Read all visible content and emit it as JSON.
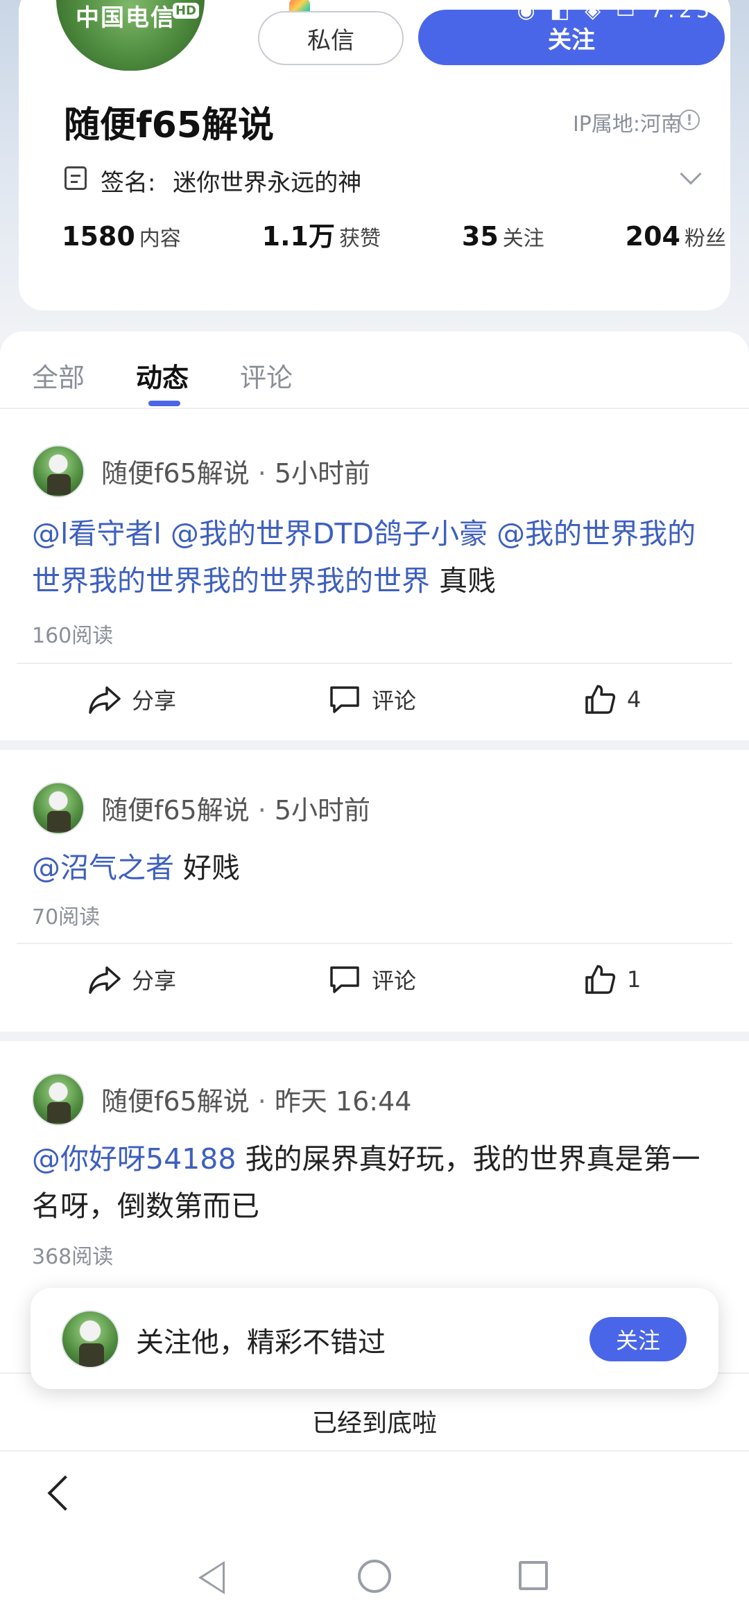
{
  "status_bar": {
    "time": "7:23",
    "carrier": "中国电信",
    "carrier_badge": "HD"
  },
  "profile": {
    "name": "随便f65解说",
    "ip_location": "IP属地:河南",
    "signature_label": "签名:",
    "signature": "迷你世界永远的神",
    "message_button": "私信",
    "follow_button": "关注",
    "stats": [
      {
        "value": "1580",
        "label": "内容"
      },
      {
        "value": "1.1万",
        "label": "获赞"
      },
      {
        "value": "35",
        "label": "关注"
      },
      {
        "value": "204",
        "label": "粉丝"
      }
    ]
  },
  "tabs": [
    {
      "label": "全部",
      "active": false
    },
    {
      "label": "动态",
      "active": true
    },
    {
      "label": "评论",
      "active": false
    }
  ],
  "posts": [
    {
      "author": "随便f65解说",
      "time": "5小时前",
      "mentions": [
        "@l看守者l",
        "@我的世界DTD鸽子小豪",
        "@我的世界我的世界我的世界我的世界我的世界"
      ],
      "text": "真贱",
      "reads": "160阅读",
      "share": "分享",
      "comment": "评论",
      "likes": "4"
    },
    {
      "author": "随便f65解说",
      "time": "5小时前",
      "mentions": [
        "@沼气之者"
      ],
      "text": "好贱",
      "reads": "70阅读",
      "share": "分享",
      "comment": "评论",
      "likes": "1"
    },
    {
      "author": "随便f65解说",
      "time": "昨天 16:44",
      "mentions": [
        "@你好呀54188"
      ],
      "text": "我的屎界真好玩，我的世界真是第一名呀，倒数第而已",
      "reads": "368阅读"
    }
  ],
  "toast": {
    "text": "关注他，精彩不错过",
    "button": "关注"
  },
  "end_text": "已经到底啦",
  "colors": {
    "accent": "#4a66e8",
    "mention": "#3d5fbf"
  }
}
